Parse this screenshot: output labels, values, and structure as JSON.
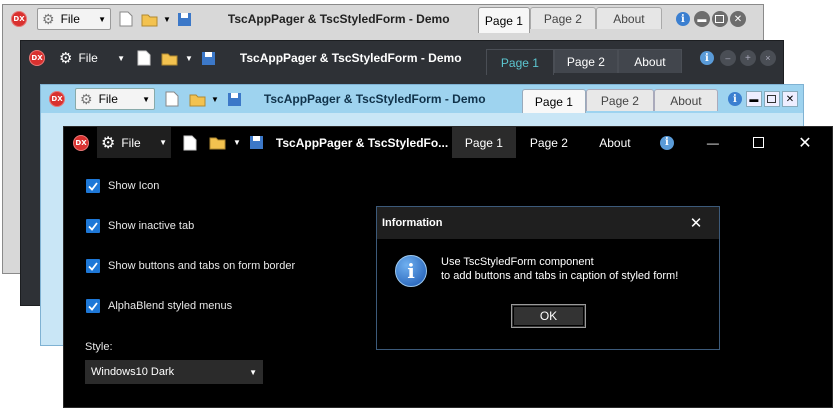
{
  "app": {
    "title": "TscAppPager & TscStyledForm - Demo",
    "title_truncated": "TscAppPager & TscStyledFo...",
    "icon_text": "DX",
    "file_menu_label": "File"
  },
  "tabs": [
    "Page 1",
    "Page 2",
    "About"
  ],
  "options": {
    "show_icon": "Show Icon",
    "show_inactive_tab": "Show inactive tab",
    "show_buttons_tabs": "Show buttons and tabs on form border",
    "alphablend": "AlphaBlend styled menus",
    "style_label": "Style:",
    "style_value": "Windows10 Dark"
  },
  "dialog": {
    "title": "Information",
    "line1": "Use TscStyledForm component",
    "line2": "to add buttons and tabs in caption of styled form!",
    "ok_label": "OK"
  },
  "icons": {
    "app": "dx-logo-icon",
    "settings": "gear-icon",
    "new": "new-document-icon",
    "open": "open-folder-icon",
    "save": "save-disk-icon",
    "info": "info-icon",
    "minimize": "minimize-icon",
    "maximize": "maximize-icon",
    "close": "close-icon"
  },
  "colors": {
    "accent_blue": "#1e78d7",
    "teal_tab_text": "#5cc6d0",
    "dark_bg": "#000000",
    "light_blue_caption": "#9ed3ef"
  }
}
